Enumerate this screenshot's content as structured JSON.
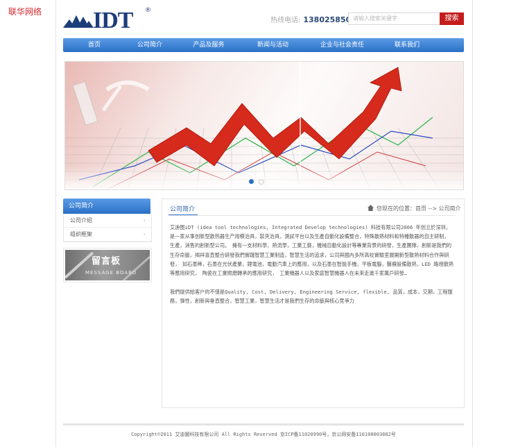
{
  "corner_brand": "联华网络",
  "header": {
    "logo_text": "IDT",
    "logo_reg": "®",
    "hotline_label": "热线电话:",
    "hotline_number": "13802585020",
    "search_placeholder": "请输入搜索关键字",
    "search_button": "搜索"
  },
  "nav": [
    "首页",
    "公司简介",
    "产品及服务",
    "新闻与活动",
    "企业与社会责任",
    "联系我们"
  ],
  "banner": {
    "active_slide": 1,
    "slide_count": 2
  },
  "sidebar": {
    "title": "公司简介",
    "items": [
      "公司介绍",
      "组织框架"
    ],
    "arrow": "›",
    "message_board_title": "留言板",
    "message_board_sub": "MESSAGE BOARD"
  },
  "main": {
    "title": "公司简介",
    "breadcrumb": "您现在的位置：首页 --> 公司简介",
    "paragraphs": [
      "艾迪图iDT (idea tool technologies, Integrated Develop technologies) 科技有限公司2006 年创立於深圳，　是一家从事创新型散热器生产用模治具，裝夾治具，測試平台以及生產自動化設備整合，特殊散熱材料和特種散器的自主研制，　生產，消售的創新型公司。　擁有一支材料學，熱流學，工業工藝，機械自動化設計等專業背景的研發，生產團隊，創新是我們的生存命脈，揭祥喜直整合研發我們實踐智慧工業制造，智慧生活的追求，公司與國內多所高校實驗室展開新型散熱材料合作與研發，　如石墨稀，石墨在光伏產業，鋰電池，電動汽車上的應用，以及石墨在智能手機，平板電腦，醫療設備散熱，LED 路燈散熱等應用研究，　陶瓷在工業照磨轉承的應用研究，　工業機器人以及家庭智慧機器人在未來走進千家萬戶研發…",
      "我們提供給客户的不僅是Quality, Cost, Delivery, Engineering Service, flexible, 品質，成本，交期，工程服務，彈性，創新與垂直整合，智慧工業，智慧生活才是我們生存的命脈與核心竞爭力"
    ]
  },
  "footer": "Copyright©2011 艾迪圖科技有限公司 All Rights Reserved 京ICP备11020990号，京公网安备110108003882号",
  "colors": {
    "nav_blue": "#2b70c6",
    "search_red": "#c41d1d",
    "logo_navy": "#1d3d7a",
    "brand_red": "#d7262b"
  }
}
